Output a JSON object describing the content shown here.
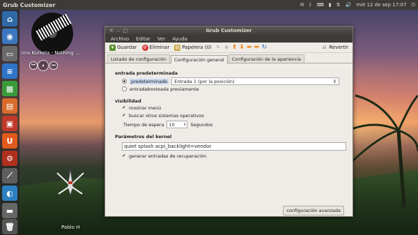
{
  "panel": {
    "app_title": "Grub Customizer",
    "datetime": "mié 12 de sep 17:07"
  },
  "desktop": {
    "track": "nna Kurkela - Nothing ...",
    "user": "Pablo H"
  },
  "window": {
    "title": "Grub Customizer",
    "menu": [
      "Archivo",
      "Editar",
      "Ver",
      "Ayuda"
    ],
    "toolbar": {
      "save": "Guardar",
      "remove": "Eliminar",
      "trash": "Papelera (0)",
      "revert": "Revertir"
    },
    "tabs": [
      "Listado de configuración",
      "Configuración general",
      "Configuración de la apariencia"
    ],
    "general": {
      "default_entry_heading": "entrada predeterminada",
      "predefined_label": "predeterminado",
      "predefined_value": "Entrada 1 (por la posición)",
      "previously_booted": "entradabooteada previamente",
      "visibility_heading": "visibilidad",
      "show_menu": "mostrar menú",
      "search_os": "buscar otros sistemas operativos",
      "timeout_label": "Tiempo de espera",
      "timeout_value": "10",
      "timeout_unit": "Segundos",
      "kernel_heading": "Parámetros del kernel",
      "kernel_params": "quiet splash acpi_backlight=vendor",
      "recovery": "generar entradas de recuperación",
      "advanced_button": "configuración avanzada"
    }
  }
}
